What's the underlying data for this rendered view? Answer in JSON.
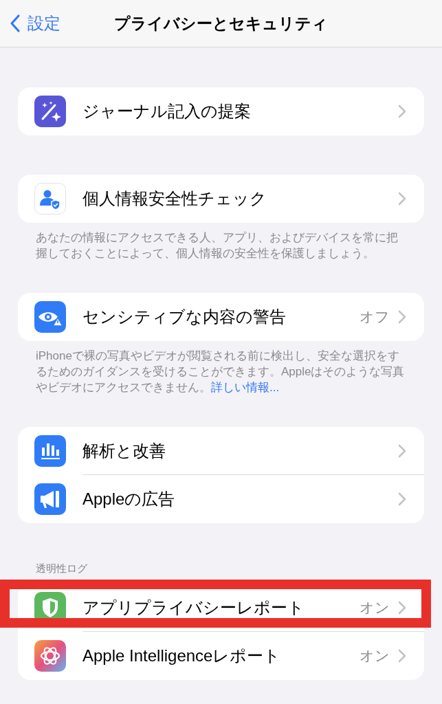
{
  "nav": {
    "back": "設定",
    "title": "プライバシーとセキュリティ"
  },
  "sections": [
    {
      "items": [
        {
          "kind": "wand",
          "label": "ジャーナル記入の提案",
          "highlighted": false
        }
      ]
    },
    {
      "items": [
        {
          "kind": "person-check",
          "label": "個人情報安全性チェック",
          "highlighted": false
        }
      ],
      "footer": {
        "text": "あなたの情報にアクセスできる人、アプリ、およびデバイスを常に把握しておくことによって、個人情報の安全性を保護しましょう。"
      }
    },
    {
      "items": [
        {
          "kind": "eye-warning",
          "label": "センシティブな内容の警告",
          "value": "オフ",
          "highlighted": false
        }
      ],
      "footer": {
        "text": "iPhoneで裸の写真やビデオが閲覧される前に検出し、安全な選択をするためのガイダンスを受けることができます。Appleはそのような写真やビデオにアクセスできません。",
        "link": "詳しい情報..."
      }
    },
    {
      "items": [
        {
          "kind": "chart",
          "label": "解析と改善",
          "highlighted": false
        },
        {
          "kind": "megaphone",
          "label": "Appleの広告",
          "highlighted": false
        }
      ]
    },
    {
      "header": "透明性ログ",
      "items": [
        {
          "kind": "shield",
          "label": "アプリプライバシーレポート",
          "value": "オン",
          "highlighted": true
        },
        {
          "kind": "intelligence",
          "label": "Apple Intelligenceレポート",
          "value": "オン",
          "highlighted": false
        }
      ]
    }
  ]
}
